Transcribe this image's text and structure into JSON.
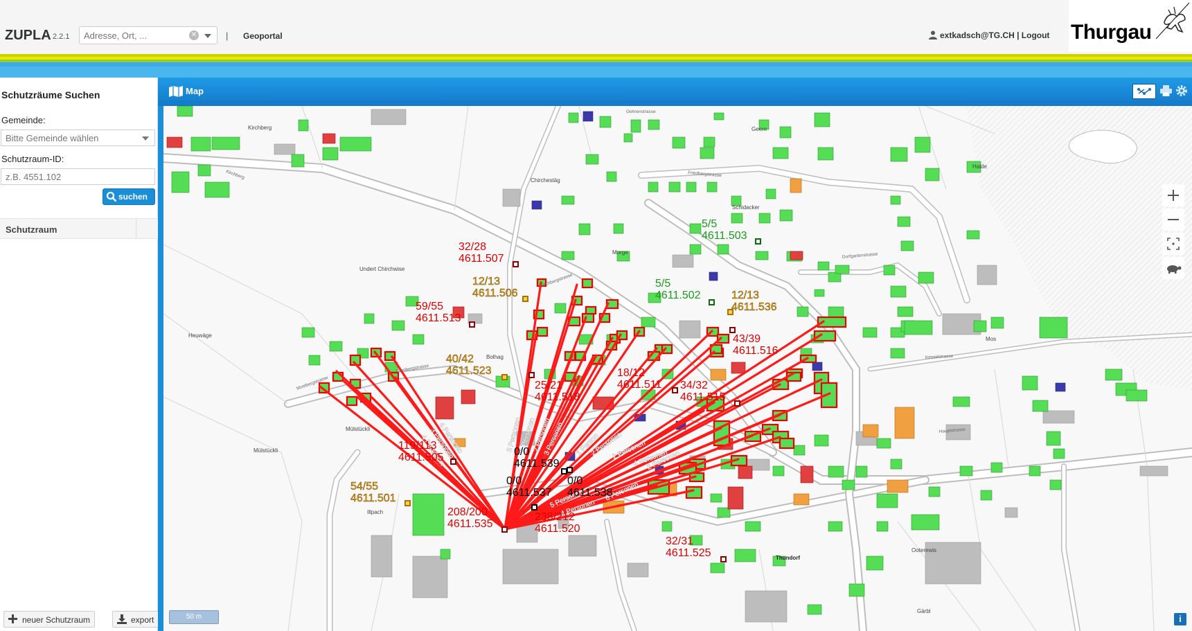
{
  "app": {
    "name": "ZUPLA",
    "version": "2.2.1"
  },
  "header": {
    "search_placeholder": "Adresse, Ort, ...",
    "separator": "|",
    "geoportal": "Geoportal",
    "user": "extkadsch@TG.CH",
    "user_sep": "|",
    "logout": "Logout",
    "logo_text": "Thurgau"
  },
  "sidebar": {
    "title": "Schutzräume Suchen",
    "gemeinde_label": "Gemeinde:",
    "gemeinde_placeholder": "Bitte Gemeinde wählen",
    "id_label": "Schutzraum-ID:",
    "id_placeholder": "z.B. 4551.102",
    "search_button": "suchen",
    "table_header": "Schutzraum",
    "new_button": "neuer Schutzraum",
    "export_button": "export"
  },
  "map": {
    "title": "Map",
    "scale": "50 m",
    "info": "i",
    "places": [
      {
        "name": "Kirchberg"
      },
      {
        "name": "Chirchestäg"
      },
      {
        "name": "Undert Chirchwise"
      },
      {
        "name": "Heuwäge"
      },
      {
        "name": "Morge"
      },
      {
        "name": "Schidacker"
      },
      {
        "name": "Bolhag"
      },
      {
        "name": "Mülstückli"
      },
      {
        "name": "Geere"
      },
      {
        "name": "Halde"
      },
      {
        "name": "Mos"
      },
      {
        "name": "Illpach"
      },
      {
        "name": "Thundorf"
      },
      {
        "name": "Ooterewis"
      },
      {
        "name": "Gärbl"
      }
    ],
    "streets": [
      {
        "name": "Kirchberg"
      },
      {
        "name": "Gehrenstrasse"
      },
      {
        "name": "Friedbergstrasse"
      },
      {
        "name": "Kirchbergstrasse"
      },
      {
        "name": "Dorfgartenstrasse"
      },
      {
        "name": "Kesselstrasse"
      },
      {
        "name": "Hauptstrasse"
      },
      {
        "name": "Ofenbergstrasse"
      },
      {
        "name": "Mostbergstrasse"
      }
    ],
    "shelters": [
      {
        "ratio": "32/28",
        "id": "4611.507",
        "color": "#e00000"
      },
      {
        "ratio": "12/13",
        "id": "4611.506",
        "color": "#f0a000"
      },
      {
        "ratio": "59/55",
        "id": "4611.513",
        "color": "#e00000"
      },
      {
        "ratio": "5/5",
        "id": "4611.503",
        "color": "#1a9b1a"
      },
      {
        "ratio": "5/5",
        "id": "4611.502",
        "color": "#1a9b1a"
      },
      {
        "ratio": "12/13",
        "id": "4611.536",
        "color": "#f0a000"
      },
      {
        "ratio": "43/39",
        "id": "4611.516",
        "color": "#e00000"
      },
      {
        "ratio": "40/42",
        "id": "4611.523",
        "color": "#f0a000"
      },
      {
        "ratio": "25/21",
        "id": "4611.518",
        "color": "#e00000"
      },
      {
        "ratio": "18/12",
        "id": "4611.511",
        "color": "#e00000"
      },
      {
        "ratio": "34/32",
        "id": "4611.515",
        "color": "#e00000"
      },
      {
        "ratio": "119/113",
        "id": "4611.505",
        "color": "#e00000"
      },
      {
        "ratio": "0/0",
        "id": "4611.539",
        "color": "#000000"
      },
      {
        "ratio": "0/0",
        "id": "4611.537",
        "color": "#000000"
      },
      {
        "ratio": "0/0",
        "id": "4611.538",
        "color": "#000000"
      },
      {
        "ratio": "54/55",
        "id": "4611.501",
        "color": "#f0a000"
      },
      {
        "ratio": "208/200",
        "id": "4611.535",
        "color": "#e00000"
      },
      {
        "ratio": "238/212",
        "id": "4611.520",
        "color": "#e00000"
      },
      {
        "ratio": "32/31",
        "id": "4611.525",
        "color": "#e00000"
      }
    ],
    "line_labels": [
      {
        "text": "4 Personen"
      },
      {
        "text": "3 Personen"
      },
      {
        "text": "4 Personen"
      },
      {
        "text": "3 Personen"
      },
      {
        "text": "1 Personen"
      },
      {
        "text": "2 Personen"
      },
      {
        "text": "3 Personen"
      },
      {
        "text": "1 Person"
      },
      {
        "text": "2 Personen"
      },
      {
        "text": "2 Personen"
      },
      {
        "text": "4 Personen"
      },
      {
        "text": "2 Personen"
      },
      {
        "text": "5 Personen"
      },
      {
        "text": "4 Personen"
      },
      {
        "text": "6 Personen"
      }
    ]
  },
  "colors": {
    "accent": "#1a8fd8",
    "assigned": "#e00000",
    "free": "#55dd55",
    "other": "#3a3aaa",
    "partial": "#f0a040"
  }
}
